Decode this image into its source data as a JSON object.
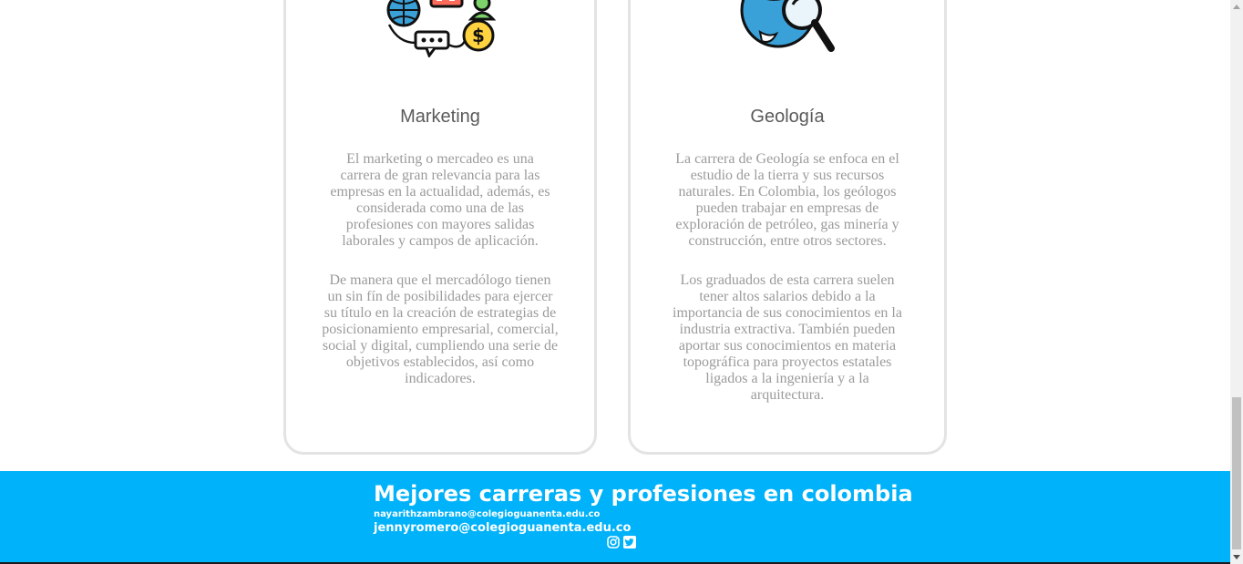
{
  "cards": [
    {
      "title": "Marketing",
      "icon": "marketing-icon",
      "paragraphs": [
        "El marketing o mercadeo es una carrera de gran relevancia para las empresas en la actualidad, además, es considerada como una de las profesiones con mayores salidas laborales y campos de aplicación.",
        "De manera que el mercadólogo tienen un sin fín de posibilidades para ejercer su título en la creación de estrategias de posicionamiento empresarial, comercial, social y digital, cumpliendo una serie de objetivos establecidos, así como indicadores."
      ]
    },
    {
      "title": "Geología",
      "icon": "geology-globe-icon",
      "paragraphs": [
        "La carrera de Geología se enfoca en el estudio de la tierra y sus recursos naturales. En Colombia, los geólogos pueden trabajar en empresas de exploración de petróleo, gas minería y construcción, entre otros sectores.",
        "Los graduados de esta carrera suelen tener altos salarios debido a la importancia de sus conocimientos en la industria extractiva. También pueden aportar sus conocimientos en materia topográfica para proyectos estatales ligados a la ingeniería y a la arquitectura."
      ]
    }
  ],
  "footer": {
    "title": "Mejores carreras y profesiones en colombia",
    "email_1": "nayarithzambrano@colegioguanenta.edu.co",
    "email_2": "jennyromero@colegioguanenta.edu.co",
    "social_icons": [
      "instagram-icon",
      "twitter-icon"
    ]
  },
  "colors": {
    "footer_bg": "#00b2f9",
    "card_border": "#e3e3e3",
    "text_gray": "#9b9b9b"
  }
}
